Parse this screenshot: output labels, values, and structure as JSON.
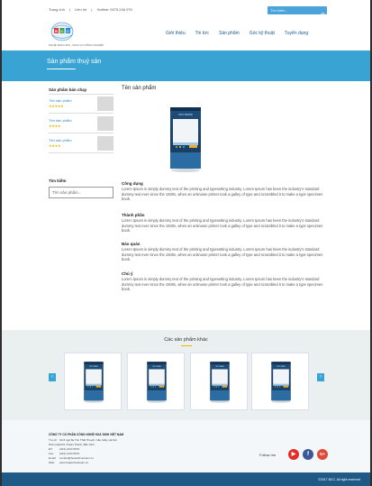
{
  "topbar": {
    "links": [
      "Trang chủ",
      "|",
      "Liên hệ",
      "|",
      "Hotline: 0975 246 075"
    ],
    "search_placeholder": "Tìm kiếm..."
  },
  "header": {
    "logo_text": "BCC",
    "logo_tagline": "NGHỆ SINH HÓA - DỊCH VỤ NÔNG NGHIỆP",
    "nav": [
      "Giới thiệu",
      "Tin tức",
      "Sản phẩm",
      "Góc kỹ thuật",
      "Tuyển dụng"
    ]
  },
  "banner": {
    "title": "Sản phẩm thuỷ sản"
  },
  "sidebar": {
    "best_sellers_title": "Sản phẩm bán chạy",
    "items": [
      {
        "name": "Tên sản phẩm",
        "stars": "★★★★★"
      },
      {
        "name": "Tên sản phẩm",
        "stars": "★★★★"
      },
      {
        "name": "Tên sản phẩm",
        "stars": "★★★★"
      }
    ],
    "search_title": "Tìm kiếm",
    "search_placeholder": "Tìm sản phẩm..."
  },
  "main": {
    "title": "Tên sản phẩm",
    "product_label": "TEXT BRAND",
    "sections": [
      {
        "heading": "Công dụng",
        "body": "Lorem Ipsum is simply dummy text of the printing and typesetting industry. Lorem Ipsum has been the industry's standard dummy text ever since the 1500s, when an unknown printer took a galley of type and scrambled it to make a type specimen book."
      },
      {
        "heading": "Thành phần",
        "body": "Lorem Ipsum is simply dummy text of the printing and typesetting industry. Lorem Ipsum has been the industry's standard dummy text ever since the 1500s, when an unknown printer took a galley of type and scrambled it to make a type specimen book."
      },
      {
        "heading": "Bảo quản",
        "body": "Lorem Ipsum is simply dummy text of the printing and typesetting industry. Lorem Ipsum has been the industry's standard dummy text ever since the 1500s, when an unknown printer took a galley of type and scrambled it to make a type specimen book."
      },
      {
        "heading": "Chú ý",
        "body": "Lorem Ipsum is simply dummy text of the printing and typesetting industry. Lorem Ipsum has been the industry's standard dummy text ever since the 1500s, when an unknown printer took a galley of type and scrambled it to make a type specimen book."
      }
    ]
  },
  "related": {
    "title": "Các sản phẩm khác",
    "prev": "‹",
    "next": "›"
  },
  "footer": {
    "company": "CÔNG TY CỔ PHẦN CÔNG NGHỆ HOÁ SINH VIỆT NAM",
    "rows": [
      {
        "k": "Trụ sở:",
        "v": "Số 8 ngõ 8a Tôn Thất Thuyết, Cầu Giấy, Hà Nội"
      },
      {
        "k": "Nhà máy:",
        "v": "KCN Thuận Thành, Bắc Ninh"
      },
      {
        "k": "ĐT:",
        "v": "(024) 1234 5678"
      },
      {
        "k": "Fax:",
        "v": "(024) 1234 5679"
      },
      {
        "k": "Email:",
        "v": "contact@hoasinhvietnam.vn"
      },
      {
        "k": "Web:",
        "v": "www.hoasinhvietnam.vn"
      }
    ],
    "follow_label": "Follow me",
    "social": [
      {
        "icon": "youtube-icon",
        "glyph": "▶",
        "color": "#e52d27"
      },
      {
        "icon": "facebook-icon",
        "glyph": "f",
        "color": "#3b5998"
      },
      {
        "icon": "google-plus-icon",
        "glyph": "G+",
        "color": "#dd4b39"
      }
    ],
    "copyright": "©2017 BCC. All right reserved"
  },
  "colors": {
    "accent": "#39a3d3",
    "dark": "#1f5a86",
    "star": "#f0b400"
  }
}
